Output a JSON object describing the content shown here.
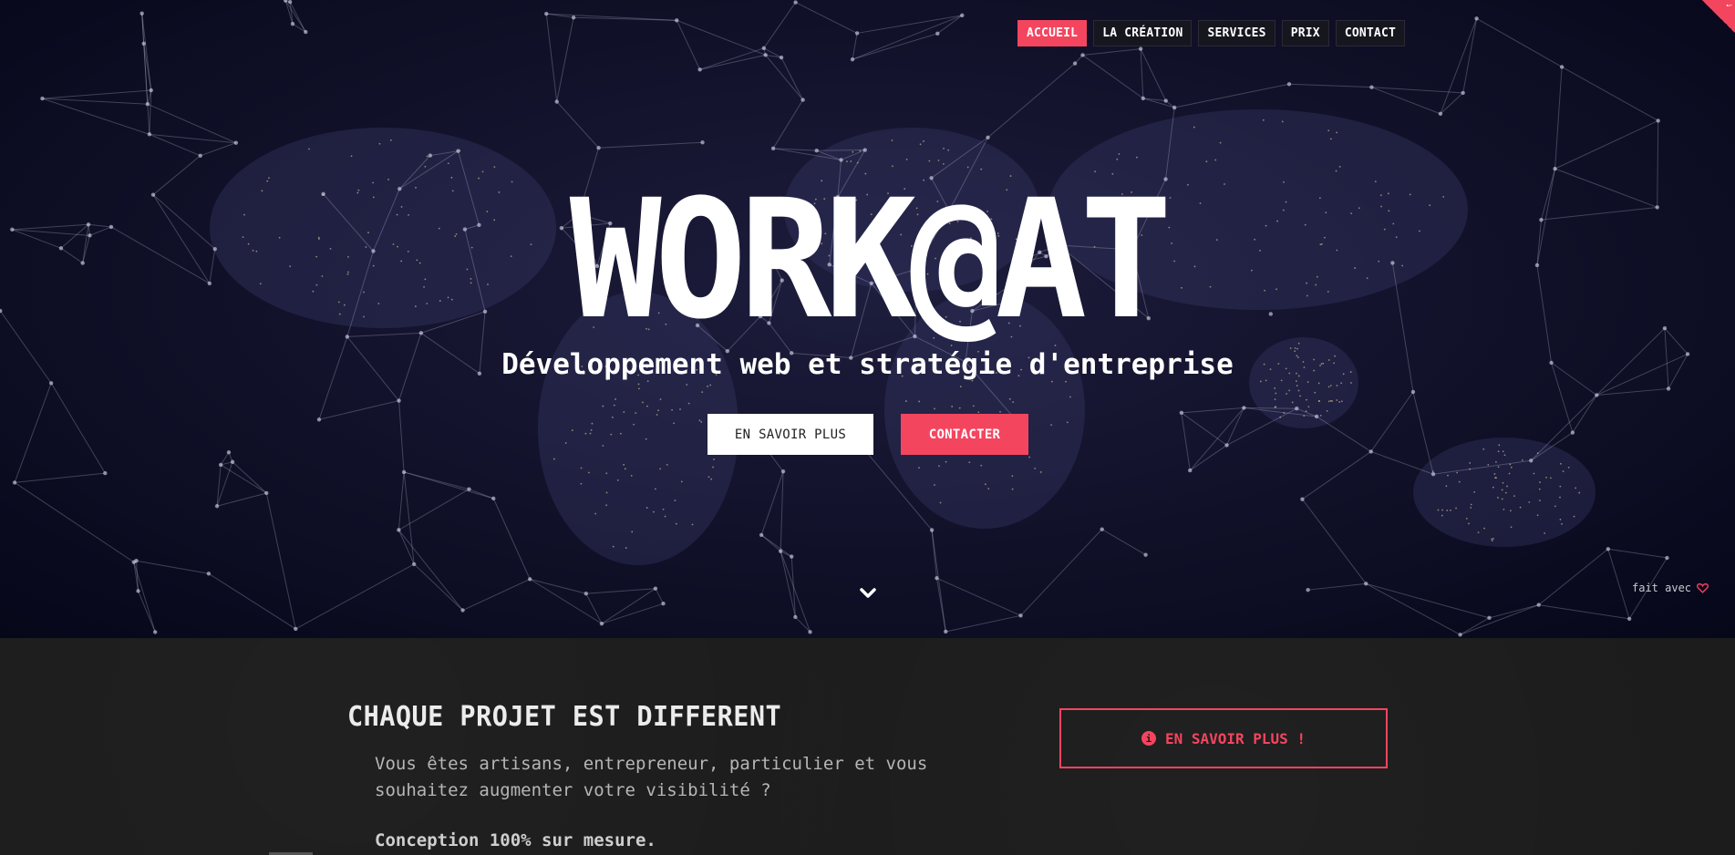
{
  "nav": {
    "items": [
      {
        "label": "ACCUEIL",
        "active": true
      },
      {
        "label": "LA CRÉATION",
        "active": false
      },
      {
        "label": "SERVICES",
        "active": false
      },
      {
        "label": "PRIX",
        "active": false
      },
      {
        "label": "CONTACT",
        "active": false
      }
    ]
  },
  "hero": {
    "title": "WORK@AT",
    "subtitle": "Développement web et stratégie d'entreprise",
    "btn_more": "EN SAVOIR PLUS",
    "btn_contact": "CONTACTER",
    "scroll_icon": "chevron-down-icon",
    "made_with": "fait avec",
    "heart_icon": "heart-icon"
  },
  "section": {
    "title": "CHAQUE PROJET EST DIFFERENT",
    "text": "Vous êtes artisans, entrepreneur, particulier et vous souhaitez augmenter votre visibilité ?",
    "bold": "Conception 100% sur mesure.",
    "button": "EN SAVOIR PLUS !",
    "button_icon": "info-icon"
  },
  "colors": {
    "accent": "#f4455f",
    "hero_bg": "#101028",
    "section_bg": "#1c1c1c"
  }
}
